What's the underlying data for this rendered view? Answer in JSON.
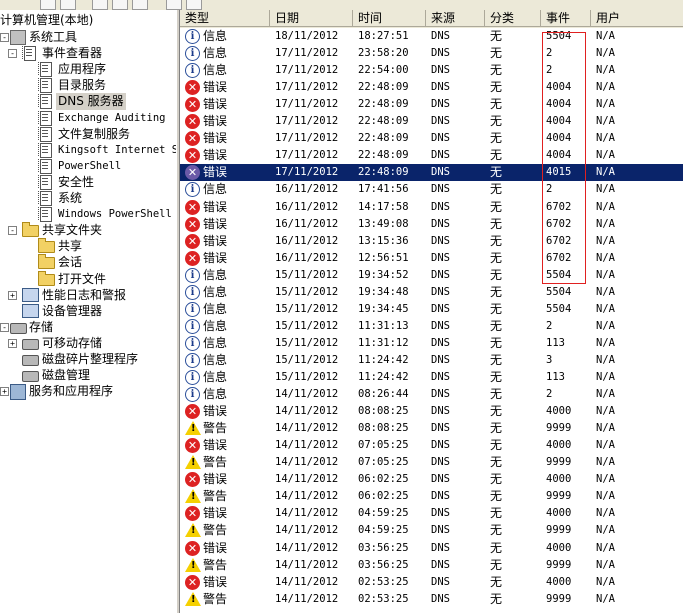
{
  "tree": {
    "root": "计算机管理(本地)",
    "nodes": [
      {
        "label": "系统工具",
        "level": 0,
        "exp": "-",
        "icon": "tool"
      },
      {
        "label": "事件查看器",
        "level": 1,
        "exp": "-",
        "icon": "log"
      },
      {
        "label": "应用程序",
        "level": 2,
        "icon": "log"
      },
      {
        "label": "目录服务",
        "level": 2,
        "icon": "log"
      },
      {
        "label": "DNS 服务器",
        "level": 2,
        "icon": "log",
        "selected": true
      },
      {
        "label": "Exchange Auditing",
        "level": 2,
        "icon": "log",
        "mono": true
      },
      {
        "label": "文件复制服务",
        "level": 2,
        "icon": "log"
      },
      {
        "label": "Kingsoft Internet S",
        "level": 2,
        "icon": "log",
        "mono": true
      },
      {
        "label": "PowerShell",
        "level": 2,
        "icon": "log",
        "mono": true
      },
      {
        "label": "安全性",
        "level": 2,
        "icon": "log"
      },
      {
        "label": "系统",
        "level": 2,
        "icon": "log"
      },
      {
        "label": "Windows PowerShell",
        "level": 2,
        "icon": "log",
        "mono": true
      },
      {
        "label": "共享文件夹",
        "level": 1,
        "exp": "-",
        "icon": "folder"
      },
      {
        "label": "共享",
        "level": 2,
        "icon": "folder"
      },
      {
        "label": "会话",
        "level": 2,
        "icon": "folder"
      },
      {
        "label": "打开文件",
        "level": 2,
        "icon": "folder"
      },
      {
        "label": "性能日志和警报",
        "level": 1,
        "exp": "+",
        "icon": "comp"
      },
      {
        "label": "设备管理器",
        "level": 1,
        "icon": "comp"
      },
      {
        "label": "存储",
        "level": 0,
        "exp": "-",
        "icon": "disk"
      },
      {
        "label": "可移动存储",
        "level": 1,
        "exp": "+",
        "icon": "disk"
      },
      {
        "label": "磁盘碎片整理程序",
        "level": 1,
        "icon": "disk"
      },
      {
        "label": "磁盘管理",
        "level": 1,
        "icon": "disk"
      },
      {
        "label": "服务和应用程序",
        "level": 0,
        "exp": "+",
        "icon": "svc"
      }
    ]
  },
  "list": {
    "columns": [
      "类型",
      "日期",
      "时间",
      "来源",
      "分类",
      "事件",
      "用户"
    ],
    "rows": [
      {
        "type": "信息",
        "kind": "info",
        "date": "18/11/2012",
        "time": "18:27:51",
        "source": "DNS",
        "category": "无",
        "event": "5504",
        "user": "N/A"
      },
      {
        "type": "信息",
        "kind": "info",
        "date": "17/11/2012",
        "time": "23:58:20",
        "source": "DNS",
        "category": "无",
        "event": "2",
        "user": "N/A"
      },
      {
        "type": "信息",
        "kind": "info",
        "date": "17/11/2012",
        "time": "22:54:00",
        "source": "DNS",
        "category": "无",
        "event": "2",
        "user": "N/A"
      },
      {
        "type": "错误",
        "kind": "error",
        "date": "17/11/2012",
        "time": "22:48:09",
        "source": "DNS",
        "category": "无",
        "event": "4004",
        "user": "N/A"
      },
      {
        "type": "错误",
        "kind": "error",
        "date": "17/11/2012",
        "time": "22:48:09",
        "source": "DNS",
        "category": "无",
        "event": "4004",
        "user": "N/A"
      },
      {
        "type": "错误",
        "kind": "error",
        "date": "17/11/2012",
        "time": "22:48:09",
        "source": "DNS",
        "category": "无",
        "event": "4004",
        "user": "N/A"
      },
      {
        "type": "错误",
        "kind": "error",
        "date": "17/11/2012",
        "time": "22:48:09",
        "source": "DNS",
        "category": "无",
        "event": "4004",
        "user": "N/A"
      },
      {
        "type": "错误",
        "kind": "error",
        "date": "17/11/2012",
        "time": "22:48:09",
        "source": "DNS",
        "category": "无",
        "event": "4004",
        "user": "N/A"
      },
      {
        "type": "错误",
        "kind": "error",
        "date": "17/11/2012",
        "time": "22:48:09",
        "source": "DNS",
        "category": "无",
        "event": "4015",
        "user": "N/A",
        "selected": true
      },
      {
        "type": "信息",
        "kind": "info",
        "date": "16/11/2012",
        "time": "17:41:56",
        "source": "DNS",
        "category": "无",
        "event": "2",
        "user": "N/A"
      },
      {
        "type": "错误",
        "kind": "error",
        "date": "16/11/2012",
        "time": "14:17:58",
        "source": "DNS",
        "category": "无",
        "event": "6702",
        "user": "N/A"
      },
      {
        "type": "错误",
        "kind": "error",
        "date": "16/11/2012",
        "time": "13:49:08",
        "source": "DNS",
        "category": "无",
        "event": "6702",
        "user": "N/A"
      },
      {
        "type": "错误",
        "kind": "error",
        "date": "16/11/2012",
        "time": "13:15:36",
        "source": "DNS",
        "category": "无",
        "event": "6702",
        "user": "N/A"
      },
      {
        "type": "错误",
        "kind": "error",
        "date": "16/11/2012",
        "time": "12:56:51",
        "source": "DNS",
        "category": "无",
        "event": "6702",
        "user": "N/A"
      },
      {
        "type": "信息",
        "kind": "info",
        "date": "15/11/2012",
        "time": "19:34:52",
        "source": "DNS",
        "category": "无",
        "event": "5504",
        "user": "N/A"
      },
      {
        "type": "信息",
        "kind": "info",
        "date": "15/11/2012",
        "time": "19:34:48",
        "source": "DNS",
        "category": "无",
        "event": "5504",
        "user": "N/A"
      },
      {
        "type": "信息",
        "kind": "info",
        "date": "15/11/2012",
        "time": "19:34:45",
        "source": "DNS",
        "category": "无",
        "event": "5504",
        "user": "N/A"
      },
      {
        "type": "信息",
        "kind": "info",
        "date": "15/11/2012",
        "time": "11:31:13",
        "source": "DNS",
        "category": "无",
        "event": "2",
        "user": "N/A"
      },
      {
        "type": "信息",
        "kind": "info",
        "date": "15/11/2012",
        "time": "11:31:12",
        "source": "DNS",
        "category": "无",
        "event": "113",
        "user": "N/A"
      },
      {
        "type": "信息",
        "kind": "info",
        "date": "15/11/2012",
        "time": "11:24:42",
        "source": "DNS",
        "category": "无",
        "event": "3",
        "user": "N/A"
      },
      {
        "type": "信息",
        "kind": "info",
        "date": "15/11/2012",
        "time": "11:24:42",
        "source": "DNS",
        "category": "无",
        "event": "113",
        "user": "N/A"
      },
      {
        "type": "信息",
        "kind": "info",
        "date": "14/11/2012",
        "time": "08:26:44",
        "source": "DNS",
        "category": "无",
        "event": "2",
        "user": "N/A"
      },
      {
        "type": "错误",
        "kind": "error",
        "date": "14/11/2012",
        "time": "08:08:25",
        "source": "DNS",
        "category": "无",
        "event": "4000",
        "user": "N/A"
      },
      {
        "type": "警告",
        "kind": "warn",
        "date": "14/11/2012",
        "time": "08:08:25",
        "source": "DNS",
        "category": "无",
        "event": "9999",
        "user": "N/A"
      },
      {
        "type": "错误",
        "kind": "error",
        "date": "14/11/2012",
        "time": "07:05:25",
        "source": "DNS",
        "category": "无",
        "event": "4000",
        "user": "N/A"
      },
      {
        "type": "警告",
        "kind": "warn",
        "date": "14/11/2012",
        "time": "07:05:25",
        "source": "DNS",
        "category": "无",
        "event": "9999",
        "user": "N/A"
      },
      {
        "type": "错误",
        "kind": "error",
        "date": "14/11/2012",
        "time": "06:02:25",
        "source": "DNS",
        "category": "无",
        "event": "4000",
        "user": "N/A"
      },
      {
        "type": "警告",
        "kind": "warn",
        "date": "14/11/2012",
        "time": "06:02:25",
        "source": "DNS",
        "category": "无",
        "event": "9999",
        "user": "N/A"
      },
      {
        "type": "错误",
        "kind": "error",
        "date": "14/11/2012",
        "time": "04:59:25",
        "source": "DNS",
        "category": "无",
        "event": "4000",
        "user": "N/A"
      },
      {
        "type": "警告",
        "kind": "warn",
        "date": "14/11/2012",
        "time": "04:59:25",
        "source": "DNS",
        "category": "无",
        "event": "9999",
        "user": "N/A"
      },
      {
        "type": "错误",
        "kind": "error",
        "date": "14/11/2012",
        "time": "03:56:25",
        "source": "DNS",
        "category": "无",
        "event": "4000",
        "user": "N/A"
      },
      {
        "type": "警告",
        "kind": "warn",
        "date": "14/11/2012",
        "time": "03:56:25",
        "source": "DNS",
        "category": "无",
        "event": "9999",
        "user": "N/A"
      },
      {
        "type": "错误",
        "kind": "error",
        "date": "14/11/2012",
        "time": "02:53:25",
        "source": "DNS",
        "category": "无",
        "event": "4000",
        "user": "N/A"
      },
      {
        "type": "警告",
        "kind": "warn",
        "date": "14/11/2012",
        "time": "02:53:25",
        "source": "DNS",
        "category": "无",
        "event": "9999",
        "user": "N/A"
      }
    ]
  },
  "colors": {
    "selection": "#0a246a",
    "highlight_box": "#e02020",
    "error": "#d22222",
    "warning": "#f5d000",
    "info": "#2b4f9a"
  }
}
